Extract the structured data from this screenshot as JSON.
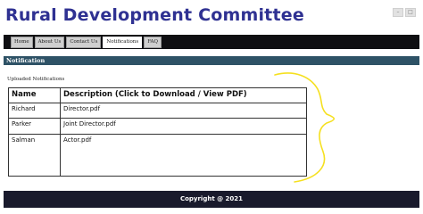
{
  "header": {
    "title": "Rural Development Committee"
  },
  "nav": {
    "tabs": [
      {
        "label": "Home",
        "active": false
      },
      {
        "label": "About Us",
        "active": false
      },
      {
        "label": "Contact Us",
        "active": false
      },
      {
        "label": "Notifications",
        "active": true
      },
      {
        "label": "FAQ",
        "active": false
      }
    ]
  },
  "section": {
    "title": "Notification"
  },
  "uploaded": {
    "label": "Uploaded Notifications"
  },
  "table": {
    "headers": {
      "name": "Name",
      "description": "Description (Click to Download / View PDF)"
    },
    "rows": [
      {
        "name": "Richard",
        "file": "Director.pdf"
      },
      {
        "name": "Parker",
        "file": "Joint Director.pdf"
      },
      {
        "name": "Salman",
        "file": "Actor.pdf"
      }
    ]
  },
  "footer": {
    "text": "Copyright @ 2021"
  },
  "colors": {
    "title": "#2f3192",
    "navbar": "#0f0f12",
    "section_bar": "#2e5266",
    "footer": "#191a2c",
    "annotation": "#f5e020"
  }
}
